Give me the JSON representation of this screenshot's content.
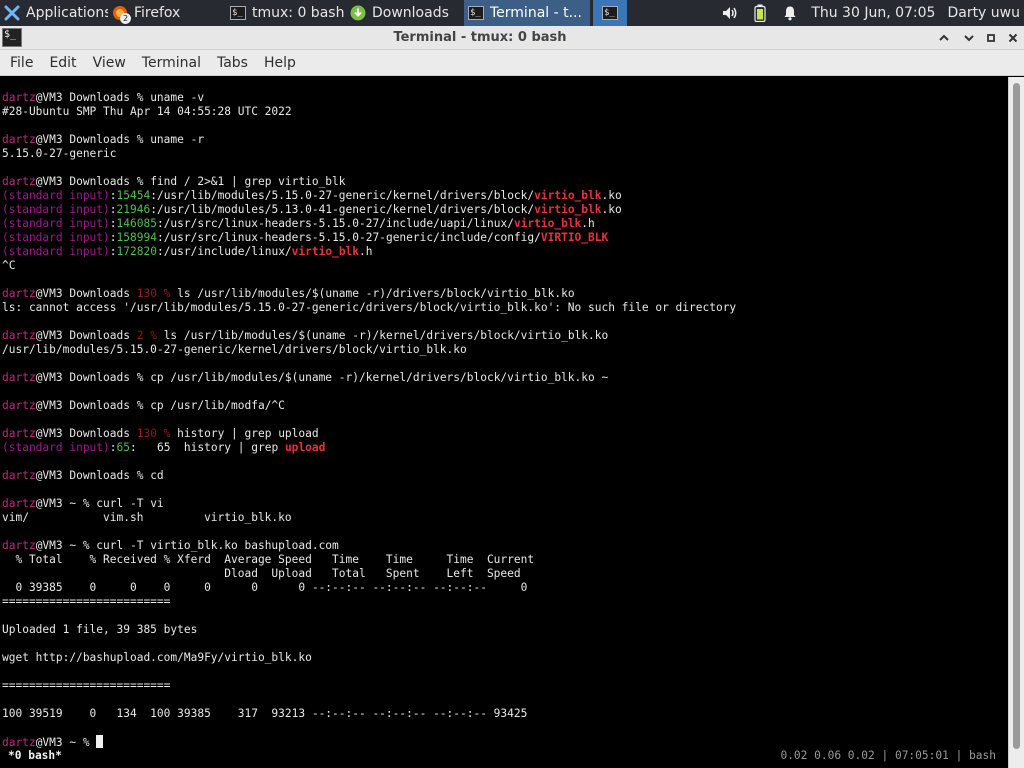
{
  "panel": {
    "applications_label": "Applications",
    "taskbar": [
      {
        "label": "Firefox",
        "badge": "2"
      },
      {
        "label": "tmux: 0 bash"
      },
      {
        "label": "Downloads"
      },
      {
        "label": "Terminal - t..."
      }
    ],
    "clock": "Thu 30 Jun, 07:05",
    "user": "Darty uwu"
  },
  "window": {
    "title": "Terminal - tmux: 0 bash"
  },
  "menu": [
    "File",
    "Edit",
    "View",
    "Terminal",
    "Tabs",
    "Help"
  ],
  "terminal": {
    "lines": [
      [
        [
          "user",
          "dartz"
        ],
        [
          "",
          "@VM3 Downloads % uname -v"
        ]
      ],
      [
        [
          "",
          "#28-Ubuntu SMP Thu Apr 14 04:55:28 UTC 2022"
        ]
      ],
      [],
      [
        [
          "user",
          "dartz"
        ],
        [
          "",
          "@VM3 Downloads % uname -r"
        ]
      ],
      [
        [
          "",
          "5.15.0-27-generic"
        ]
      ],
      [],
      [
        [
          "user",
          "dartz"
        ],
        [
          "",
          "@VM3 Downloads % find / 2>&1 | grep virtio_blk"
        ]
      ],
      [
        [
          "si",
          "(standard input)"
        ],
        [
          "",
          ":"
        ],
        [
          "green",
          "15454"
        ],
        [
          "",
          ":/usr/lib/modules/5.15.0-27-generic/kernel/drivers/block/"
        ],
        [
          "red",
          "virtio_blk"
        ],
        [
          "",
          ".ko"
        ]
      ],
      [
        [
          "si",
          "(standard input)"
        ],
        [
          "",
          ":"
        ],
        [
          "green",
          "21946"
        ],
        [
          "",
          ":/usr/lib/modules/5.13.0-41-generic/kernel/drivers/block/"
        ],
        [
          "red",
          "virtio_blk"
        ],
        [
          "",
          ".ko"
        ]
      ],
      [
        [
          "si",
          "(standard input)"
        ],
        [
          "",
          ":"
        ],
        [
          "green",
          "146085"
        ],
        [
          "",
          ":/usr/src/linux-headers-5.15.0-27/include/uapi/linux/"
        ],
        [
          "red",
          "virtio_blk"
        ],
        [
          "",
          ".h"
        ]
      ],
      [
        [
          "si",
          "(standard input)"
        ],
        [
          "",
          ":"
        ],
        [
          "green",
          "158994"
        ],
        [
          "",
          ":/usr/src/linux-headers-5.15.0-27-generic/include/config/"
        ],
        [
          "red",
          "VIRTIO_BLK"
        ]
      ],
      [
        [
          "si",
          "(standard input)"
        ],
        [
          "",
          ":"
        ],
        [
          "green",
          "172820"
        ],
        [
          "",
          ":/usr/include/linux/"
        ],
        [
          "red",
          "virtio_blk"
        ],
        [
          "",
          ".h"
        ]
      ],
      [
        [
          "",
          "^C"
        ]
      ],
      [],
      [
        [
          "user",
          "dartz"
        ],
        [
          "",
          "@VM3 Downloads "
        ],
        [
          "dimred",
          "130 %"
        ],
        [
          "",
          " ls /usr/lib/modules/$(uname -r)/drivers/block/virtio_blk.ko"
        ]
      ],
      [
        [
          "",
          "ls: cannot access '/usr/lib/modules/5.15.0-27-generic/drivers/block/virtio_blk.ko': No such file or directory"
        ]
      ],
      [],
      [
        [
          "user",
          "dartz"
        ],
        [
          "",
          "@VM3 Downloads "
        ],
        [
          "dimred",
          "2 %"
        ],
        [
          "",
          " ls /usr/lib/modules/$(uname -r)/kernel/drivers/block/virtio_blk.ko"
        ]
      ],
      [
        [
          "",
          "/usr/lib/modules/5.15.0-27-generic/kernel/drivers/block/virtio_blk.ko"
        ]
      ],
      [],
      [
        [
          "user",
          "dartz"
        ],
        [
          "",
          "@VM3 Downloads % cp /usr/lib/modules/$(uname -r)/kernel/drivers/block/virtio_blk.ko ~"
        ]
      ],
      [],
      [
        [
          "user",
          "dartz"
        ],
        [
          "",
          "@VM3 Downloads % cp /usr/lib/modfa/^C"
        ]
      ],
      [],
      [
        [
          "user",
          "dartz"
        ],
        [
          "",
          "@VM3 Downloads "
        ],
        [
          "dimred",
          "130 %"
        ],
        [
          "",
          " history | grep upload"
        ]
      ],
      [
        [
          "si",
          "(standard input)"
        ],
        [
          "",
          ":"
        ],
        [
          "green",
          "65"
        ],
        [
          "",
          ":   65  history | grep "
        ],
        [
          "red",
          "upload"
        ]
      ],
      [],
      [
        [
          "user",
          "dartz"
        ],
        [
          "",
          "@VM3 Downloads % cd"
        ]
      ],
      [],
      [
        [
          "user",
          "dartz"
        ],
        [
          "",
          "@VM3 ~ % curl -T vi"
        ]
      ],
      [
        [
          "",
          "vim/           vim.sh         virtio_blk.ko"
        ]
      ],
      [],
      [
        [
          "user",
          "dartz"
        ],
        [
          "",
          "@VM3 ~ % curl -T virtio_blk.ko bashupload.com"
        ]
      ],
      [
        [
          "",
          "  % Total    % Received % Xferd  Average Speed   Time    Time     Time  Current"
        ]
      ],
      [
        [
          "",
          "                                 Dload  Upload   Total   Spent    Left  Speed"
        ]
      ],
      [
        [
          "",
          "  0 39385    0     0    0     0      0      0 --:--:-- --:--:-- --:--:--     0"
        ]
      ],
      [
        [
          "",
          "========================="
        ]
      ],
      [],
      [
        [
          "",
          "Uploaded 1 file, 39 385 bytes"
        ]
      ],
      [],
      [
        [
          "",
          "wget http://bashupload.com/Ma9Fy/virtio_blk.ko"
        ]
      ],
      [],
      [
        [
          "",
          "========================="
        ]
      ],
      [],
      [
        [
          "",
          "100 39519    0   134  100 39385    317  93213 --:--:-- --:--:-- --:--:-- 93425"
        ]
      ],
      [],
      [
        [
          "user",
          "dartz"
        ],
        [
          "",
          "@VM3 ~ % "
        ]
      ]
    ]
  },
  "tmux_status": {
    "window": "*0 bash*",
    "right": "0.02 0.06 0.02 | 07:05:01 | bash"
  }
}
